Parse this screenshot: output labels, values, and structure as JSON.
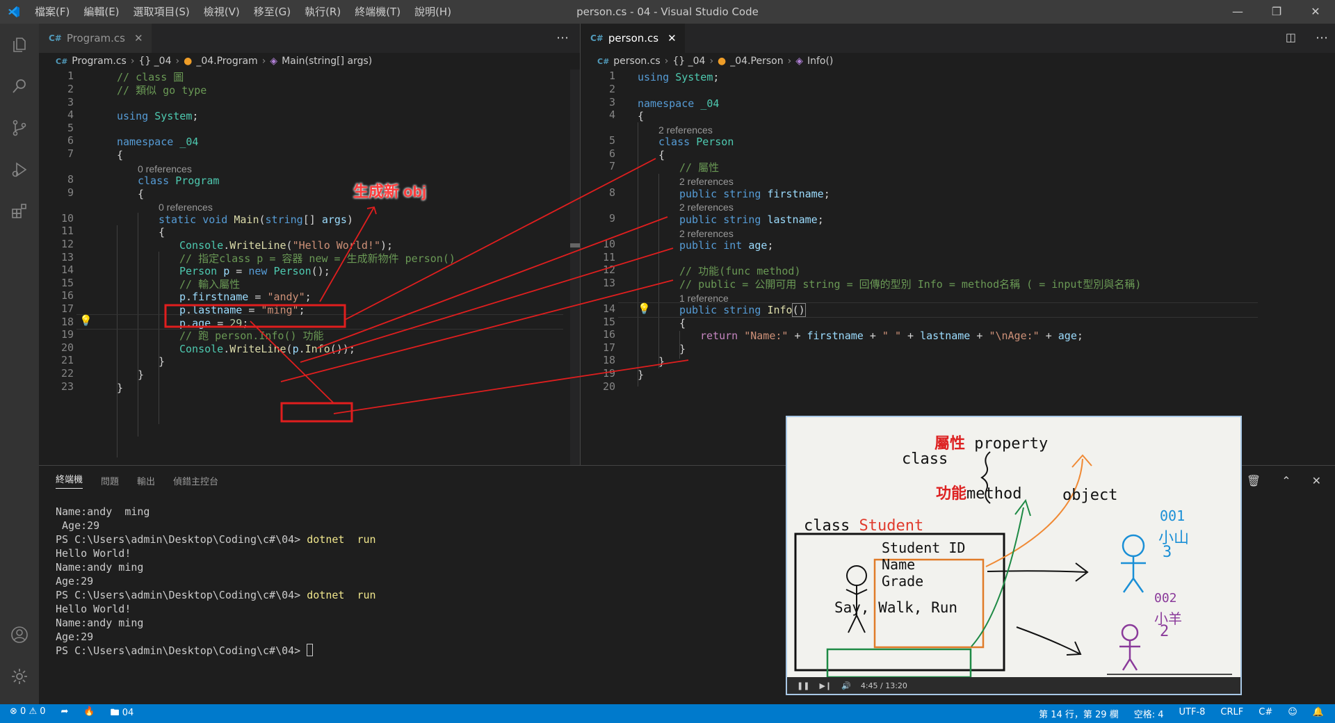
{
  "titlebar": {
    "menus": [
      "檔案(F)",
      "編輯(E)",
      "選取項目(S)",
      "檢視(V)",
      "移至(G)",
      "執行(R)",
      "終端機(T)",
      "說明(H)"
    ],
    "title": "person.cs - 04 - Visual Studio Code"
  },
  "left_editor": {
    "tab_label": "Program.cs",
    "breadcrumb": [
      "Program.cs",
      "{} _04",
      "_04.Program",
      "Main(string[] args)"
    ]
  },
  "right_editor": {
    "tab_label": "person.cs",
    "breadcrumb": [
      "person.cs",
      "{} _04",
      "_04.Person",
      "Info()"
    ]
  },
  "codelens": {
    "zero_refs": "0 references",
    "two_refs": "2 references",
    "one_ref": "1 reference"
  },
  "panel": {
    "tabs": [
      "終端機",
      "問題",
      "輸出",
      "偵錯主控台"
    ],
    "terminal_lines": [
      "Name:andy  ming",
      " Age:29",
      "PS C:\\Users\\admin\\Desktop\\Coding\\c#\\04> ",
      "Hello World!",
      "Name:andy ming",
      "Age:29",
      "PS C:\\Users\\admin\\Desktop\\Coding\\c#\\04> ",
      "Hello World!",
      "Name:andy ming",
      "Age:29",
      "PS C:\\Users\\admin\\Desktop\\Coding\\c#\\04> "
    ],
    "command": "dotnet  run"
  },
  "annotation": {
    "label": "生成新 obj"
  },
  "video": {
    "class_word": "class",
    "attr_zh": "屬性",
    "attr_en": "property",
    "method_zh": "功能",
    "method_en": "method",
    "object_word": "object",
    "class_label": "class",
    "class_name": "Student",
    "fields": [
      "Student ID",
      "Name",
      "Grade"
    ],
    "methods": "Say, Walk, Run",
    "obj1": [
      "001",
      "小山",
      "3"
    ],
    "obj2": [
      "002",
      "小羊",
      "2"
    ],
    "time": "4:45 / 13:20"
  },
  "statusbar": {
    "errors": "0",
    "warnings": "0",
    "branch": "04",
    "position": "第 14 行，第 29 欄",
    "spaces": "空格: 4",
    "encoding": "UTF-8",
    "eol": "CRLF",
    "language": "C#"
  }
}
